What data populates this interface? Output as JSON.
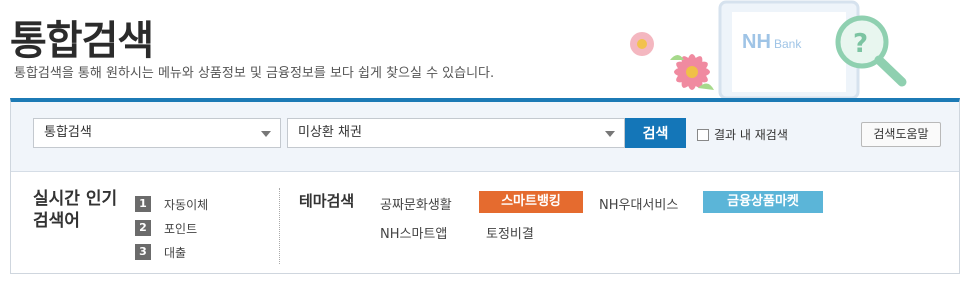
{
  "header": {
    "title": "통합검색",
    "description": "통합검색을 통해 원하시는 메뉴와 상품정보 및 금융정보를 보다 쉽게 찾으실 수 있습니다.",
    "illustration_text": "NHBank"
  },
  "search": {
    "category_value": "통합검색",
    "keyword_value": "미상환 채권",
    "search_button": "검색",
    "recheck_label": "결과 내 재검색",
    "help_button": "검색도움말"
  },
  "popular": {
    "title": "실시간 인기 검색어",
    "items": [
      {
        "rank": "1",
        "label": "자동이체"
      },
      {
        "rank": "2",
        "label": "포인트"
      },
      {
        "rank": "3",
        "label": "대출"
      }
    ]
  },
  "theme": {
    "title": "테마검색",
    "items": [
      {
        "label": "공짜문화생활",
        "style": "plain"
      },
      {
        "label": "스마트뱅킹",
        "style": "orange"
      },
      {
        "label": "NH우대서비스",
        "style": "plain"
      },
      {
        "label": "금융상품마켓",
        "style": "blue"
      },
      {
        "label": "NH스마트앱",
        "style": "plain"
      },
      {
        "label": "토정비결",
        "style": "plain"
      }
    ]
  },
  "colors": {
    "accent": "#1c7ab5",
    "search_button": "#1476b8",
    "tag_orange": "#e56b2f",
    "tag_blue": "#5bb5d8"
  }
}
